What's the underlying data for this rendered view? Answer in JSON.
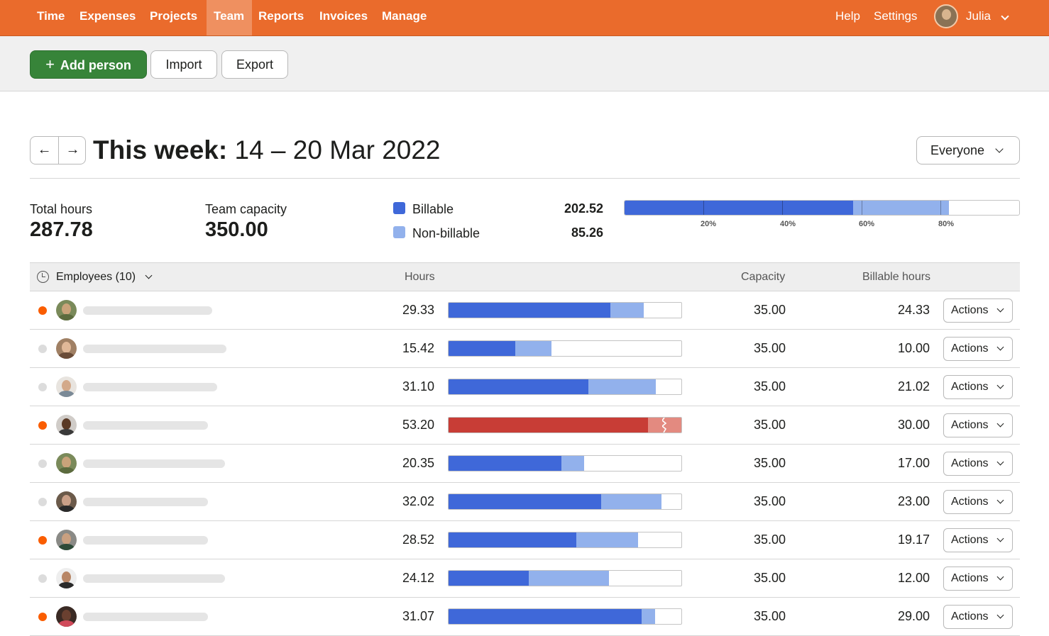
{
  "nav": {
    "items": [
      "Time",
      "Expenses",
      "Projects",
      "Team",
      "Reports",
      "Invoices",
      "Manage"
    ],
    "active": "Team",
    "help": "Help",
    "settings": "Settings",
    "user": "Julia"
  },
  "toolbar": {
    "add_person": "Add person",
    "add_icon": "+",
    "import": "Import",
    "export": "Export"
  },
  "header": {
    "prev_icon": "←",
    "next_icon": "→",
    "title_bold": "This week:",
    "title_range": "14 – 20 Mar 2022",
    "filter": "Everyone"
  },
  "summary": {
    "total_hours_label": "Total hours",
    "total_hours": "287.78",
    "capacity_label": "Team capacity",
    "capacity": "350.00",
    "billable_label": "Billable",
    "billable": "202.52",
    "nonbillable_label": "Non-billable",
    "nonbillable": "85.26",
    "ticks": [
      "20%",
      "40%",
      "60%",
      "80%"
    ]
  },
  "colors": {
    "billable": "#3f68d9",
    "nonbillable": "#92b1ec",
    "over_billable": "#c83d36",
    "over_nonbillable": "#e38a80",
    "active_dot": "#fa5d00",
    "inactive_dot": "#dcdcdc"
  },
  "table": {
    "employees_header": "Employees (10)",
    "hours_header": "Hours",
    "capacity_header": "Capacity",
    "billable_header": "Billable hours",
    "actions_label": "Actions",
    "rows": [
      {
        "hours": "29.33",
        "capacity": "35.00",
        "billable": "24.33",
        "active": true,
        "billable_frac": 0.695,
        "total_frac": 0.838,
        "over": false
      },
      {
        "hours": "15.42",
        "capacity": "35.00",
        "billable": "10.00",
        "active": false,
        "billable_frac": 0.286,
        "total_frac": 0.441,
        "over": false
      },
      {
        "hours": "31.10",
        "capacity": "35.00",
        "billable": "21.02",
        "active": false,
        "billable_frac": 0.601,
        "total_frac": 0.889,
        "over": false
      },
      {
        "hours": "53.20",
        "capacity": "35.00",
        "billable": "30.00",
        "active": true,
        "billable_frac": 0.857,
        "total_frac": 1.0,
        "over": true
      },
      {
        "hours": "20.35",
        "capacity": "35.00",
        "billable": "17.00",
        "active": false,
        "billable_frac": 0.486,
        "total_frac": 0.581,
        "over": false
      },
      {
        "hours": "32.02",
        "capacity": "35.00",
        "billable": "23.00",
        "active": false,
        "billable_frac": 0.657,
        "total_frac": 0.915,
        "over": false
      },
      {
        "hours": "28.52",
        "capacity": "35.00",
        "billable": "19.17",
        "active": true,
        "billable_frac": 0.548,
        "total_frac": 0.815,
        "over": false
      },
      {
        "hours": "24.12",
        "capacity": "35.00",
        "billable": "12.00",
        "active": false,
        "billable_frac": 0.343,
        "total_frac": 0.689,
        "over": false
      },
      {
        "hours": "31.07",
        "capacity": "35.00",
        "billable": "29.00",
        "active": true,
        "billable_frac": 0.829,
        "total_frac": 0.888,
        "over": false
      }
    ]
  },
  "summary_bar": {
    "billable_frac": 0.579,
    "total_frac": 0.822
  }
}
